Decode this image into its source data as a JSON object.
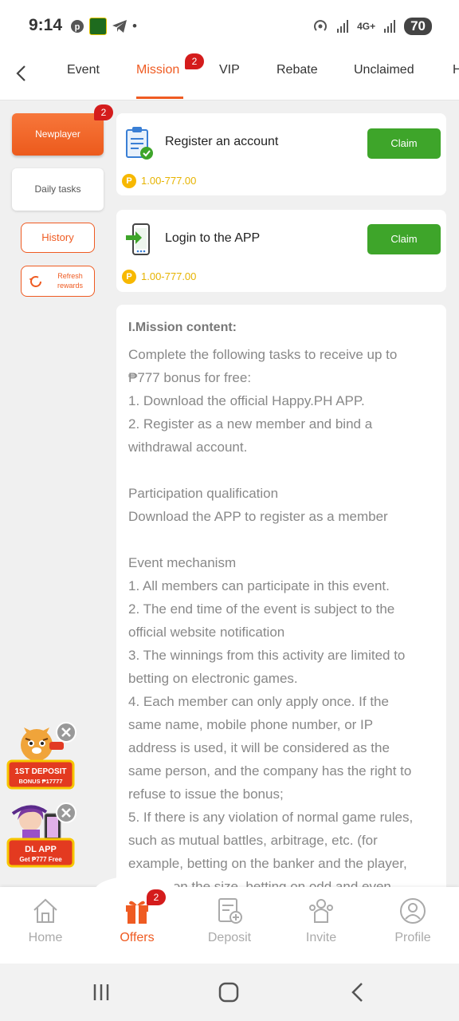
{
  "status_bar": {
    "time": "9:14",
    "network": "4G+",
    "battery": "70"
  },
  "nav": {
    "tabs": [
      {
        "label": "Event"
      },
      {
        "label": "Mission",
        "badge": "2"
      },
      {
        "label": "VIP"
      },
      {
        "label": "Rebate"
      },
      {
        "label": "Unclaimed"
      },
      {
        "label": "H"
      }
    ],
    "active_tab": "Mission"
  },
  "sidebar": {
    "newplayer": "Newplayer",
    "newplayer_badge": "2",
    "daily_tasks": "Daily tasks",
    "history": "History",
    "refresh_line1": "Refresh",
    "refresh_line2": "rewards"
  },
  "tasks": [
    {
      "title": "Register an account",
      "button": "Claim",
      "reward": "1.00-777.00",
      "icon": "clipboard-check-icon"
    },
    {
      "title": "Login to the APP",
      "button": "Claim",
      "reward": "1.00-777.00",
      "icon": "phone-login-icon"
    }
  ],
  "coin_symbol": "P",
  "mission": {
    "heading": "I.Mission content:",
    "lines": [
      "Complete the following tasks to receive up to",
      "₱777 bonus for free:",
      "1. Download the official Happy.PH APP.",
      "2. Register as a new member and bind a",
      "withdrawal account.",
      "",
      "Participation qualification",
      "Download the APP to register as a member",
      "",
      "Event mechanism",
      "1. All members can participate in this event.",
      "2. The end time of the event is subject to the",
      "official website notification",
      "3. The winnings from this activity are limited to",
      "betting on electronic games.",
      "4. Each member can only apply once. If the",
      "same name, mobile phone number, or IP",
      "address is used, it will be considered as the",
      "same person, and the company has the right to",
      "refuse to issue the bonus;",
      "5. If there is any violation of normal game rules,",
      "such as mutual battles, arbitrage, etc. (for",
      "example, betting on the banker and the player,",
      "betting on the size, betting on odd and even"
    ]
  },
  "promos": [
    {
      "line1": "1ST DEPOSIT",
      "line2": "BONUS ₱17777"
    },
    {
      "line1": "DL APP",
      "line2": "Get ₱777 Free"
    }
  ],
  "bottom_nav": {
    "items": [
      {
        "label": "Home",
        "icon": "home-icon"
      },
      {
        "label": "Offers",
        "icon": "gift-icon",
        "badge": "2"
      },
      {
        "label": "Deposit",
        "icon": "deposit-icon"
      },
      {
        "label": "Invite",
        "icon": "invite-icon"
      },
      {
        "label": "Profile",
        "icon": "profile-icon"
      }
    ],
    "active": "Offers"
  },
  "colors": {
    "accent": "#ef5b22",
    "claim_green": "#3ea52a",
    "badge_red": "#d41c1c",
    "coin_gold": "#f7b800"
  }
}
